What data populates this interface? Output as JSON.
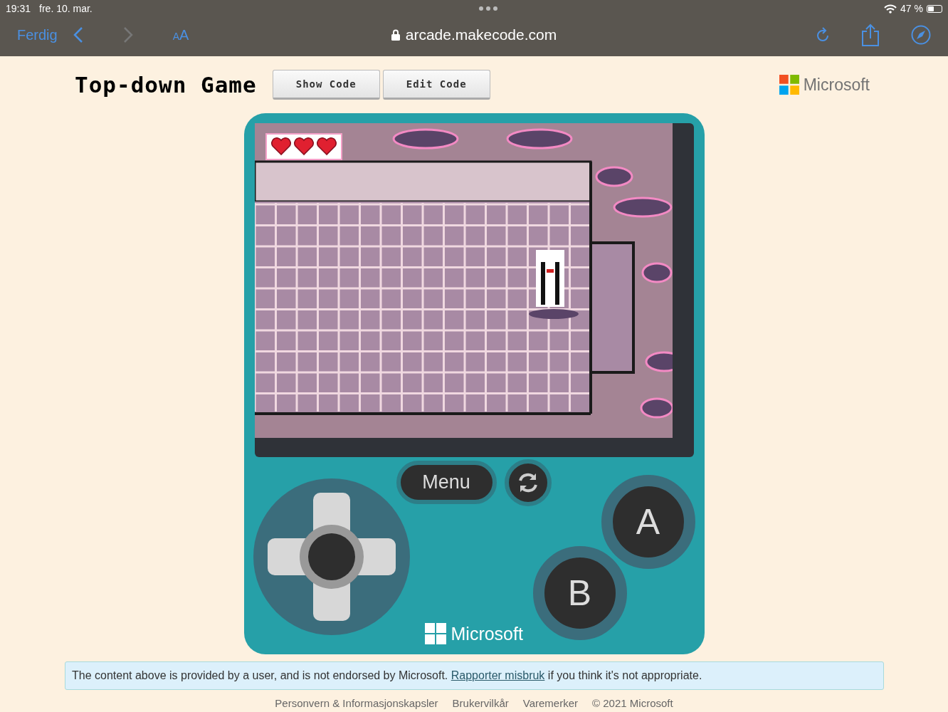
{
  "status_bar": {
    "time": "19:31",
    "date": "fre. 10. mar.",
    "battery": "47 %"
  },
  "browser": {
    "done_button": "Ferdig",
    "text_size_button": "AA",
    "url": "arcade.makecode.com",
    "back_enabled": true,
    "forward_enabled": false
  },
  "header": {
    "title": "Top-down Game",
    "buttons": [
      "Show Code",
      "Edit Code"
    ],
    "logo_text": "Microsoft"
  },
  "console": {
    "hearts": [
      {
        "filled": true
      },
      {
        "filled": true
      },
      {
        "filled": true
      }
    ],
    "menu_button": "Menu",
    "a_button": "A",
    "b_button": "B",
    "brand": "Microsoft"
  },
  "notice": {
    "text_before": "The content above is provided by a user, and is not endorsed by Microsoft.",
    "link": "Rapporter misbruk",
    "text_after": "if you think it's not appropriate."
  },
  "footer": {
    "links": [
      "Personvern & Informasjonskapsler",
      "Brukervilkår",
      "Varemerker",
      "© 2021 Microsoft"
    ]
  }
}
